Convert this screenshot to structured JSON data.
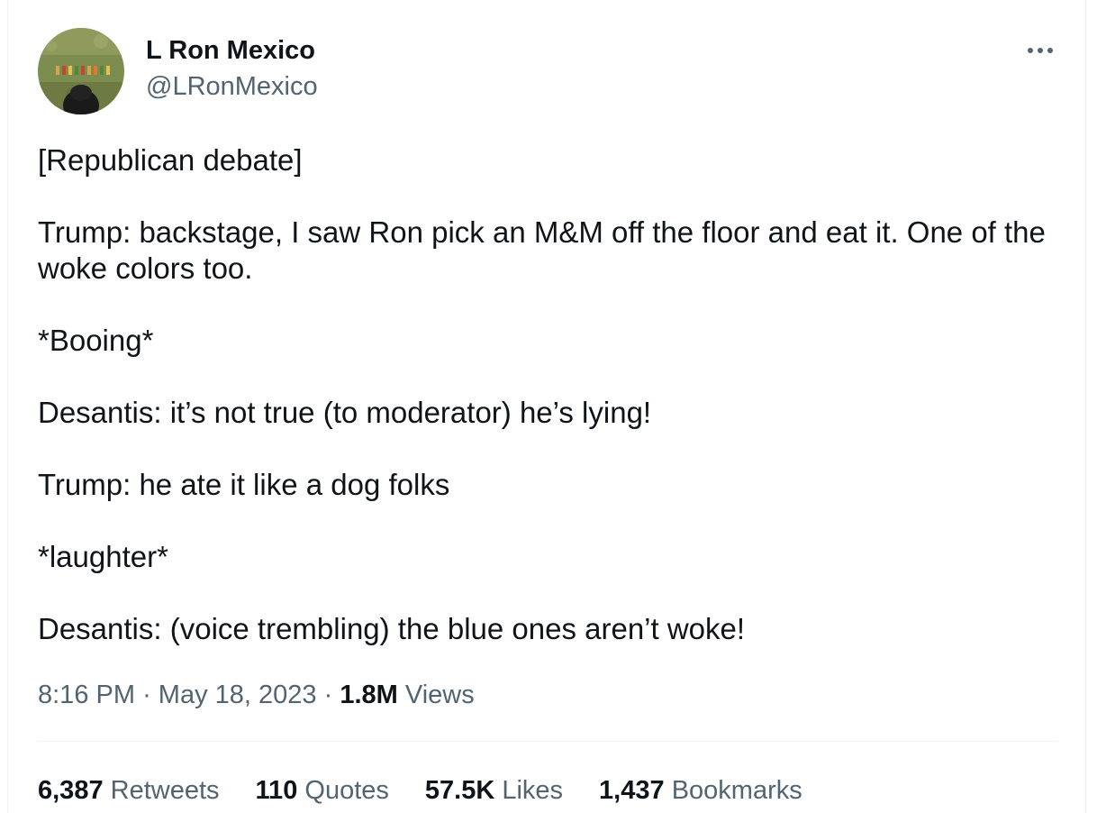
{
  "author": {
    "name": "L Ron Mexico",
    "handle": "@LRonMexico",
    "avatar_icon": "avatar-dog-in-grass"
  },
  "more_icon": "ellipsis-icon",
  "tweet": {
    "paragraphs": [
      "[Republican debate]",
      "Trump: backstage, I saw Ron pick an M&M off the floor and eat it. One of the woke colors too.",
      "*Booing*",
      "Desantis: it’s not true (to moderator) he’s lying!",
      "Trump: he ate it like a dog folks",
      "*laughter*",
      "Desantis: (voice trembling) the blue ones aren’t woke!"
    ]
  },
  "meta": {
    "time": "8:16 PM",
    "separator": "·",
    "date": "May 18, 2023",
    "views_count": "1.8M",
    "views_label": "Views"
  },
  "stats": [
    {
      "count": "6,387",
      "label": "Retweets"
    },
    {
      "count": "110",
      "label": "Quotes"
    },
    {
      "count": "57.5K",
      "label": "Likes"
    },
    {
      "count": "1,437",
      "label": "Bookmarks"
    }
  ],
  "colors": {
    "text": "#0f1419",
    "secondary": "#536471",
    "divider": "#eff3f4"
  }
}
